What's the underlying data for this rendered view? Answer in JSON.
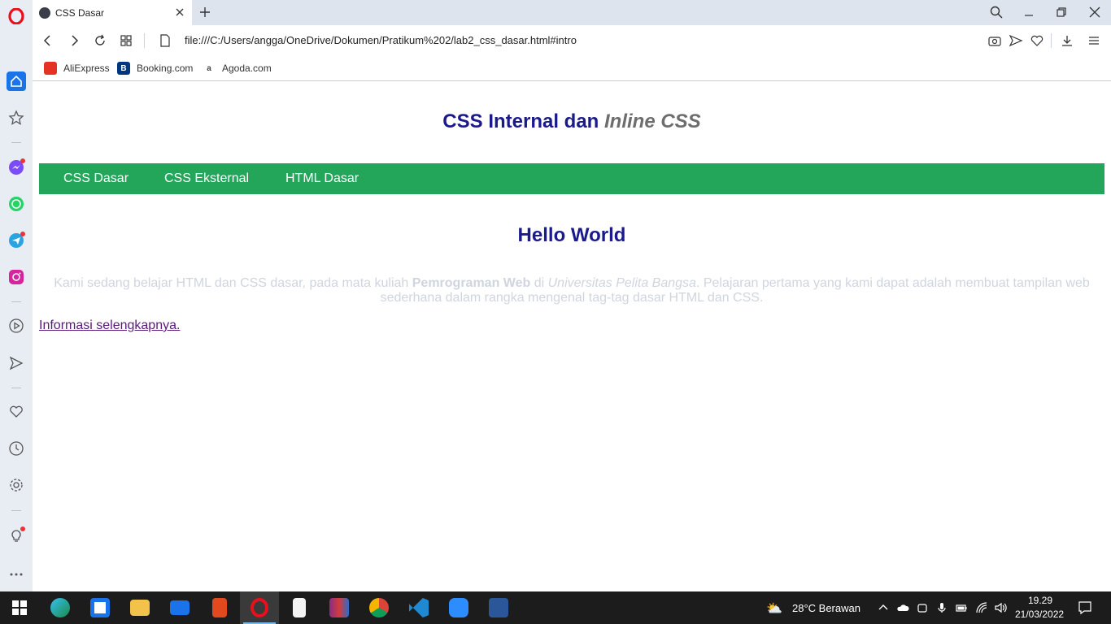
{
  "tab": {
    "title": "CSS Dasar"
  },
  "address": {
    "url": "file:///C:/Users/angga/OneDrive/Dokumen/Pratikum%202/lab2_css_dasar.html#intro"
  },
  "bookmarks": [
    {
      "label": "AliExpress",
      "color": "#e43225"
    },
    {
      "label": "Booking.com",
      "color": "#003580"
    },
    {
      "label": "Agoda.com",
      "color": "#ffffff"
    }
  ],
  "page": {
    "title_main": "CSS Internal dan ",
    "title_italic": "Inline CSS",
    "nav": [
      "CSS Dasar",
      "CSS Eksternal",
      "HTML Dasar"
    ],
    "heading": "Hello World",
    "intro_1": "Kami sedang belajar HTML dan CSS dasar, pada mata kuliah ",
    "intro_bold": "Pemrograman Web",
    "intro_2": " di ",
    "intro_italic": "Universitas Pelita Bangsa",
    "intro_3": ". Pelajaran pertama yang kami dapat adalah membuat tampilan web sederhana dalam rangka mengenal tag-tag dasar HTML dan CSS.",
    "link": "Informasi selengkapnya."
  },
  "colors": {
    "navbar": "#23a55a",
    "title": "#1a1a8c",
    "italic_title": "#6d6d6d",
    "intro_text": "#cfd5df",
    "link": "#5a1a7a"
  },
  "taskbar": {
    "weather": "28°C  Berawan",
    "time": "19.29",
    "date": "21/03/2022"
  }
}
